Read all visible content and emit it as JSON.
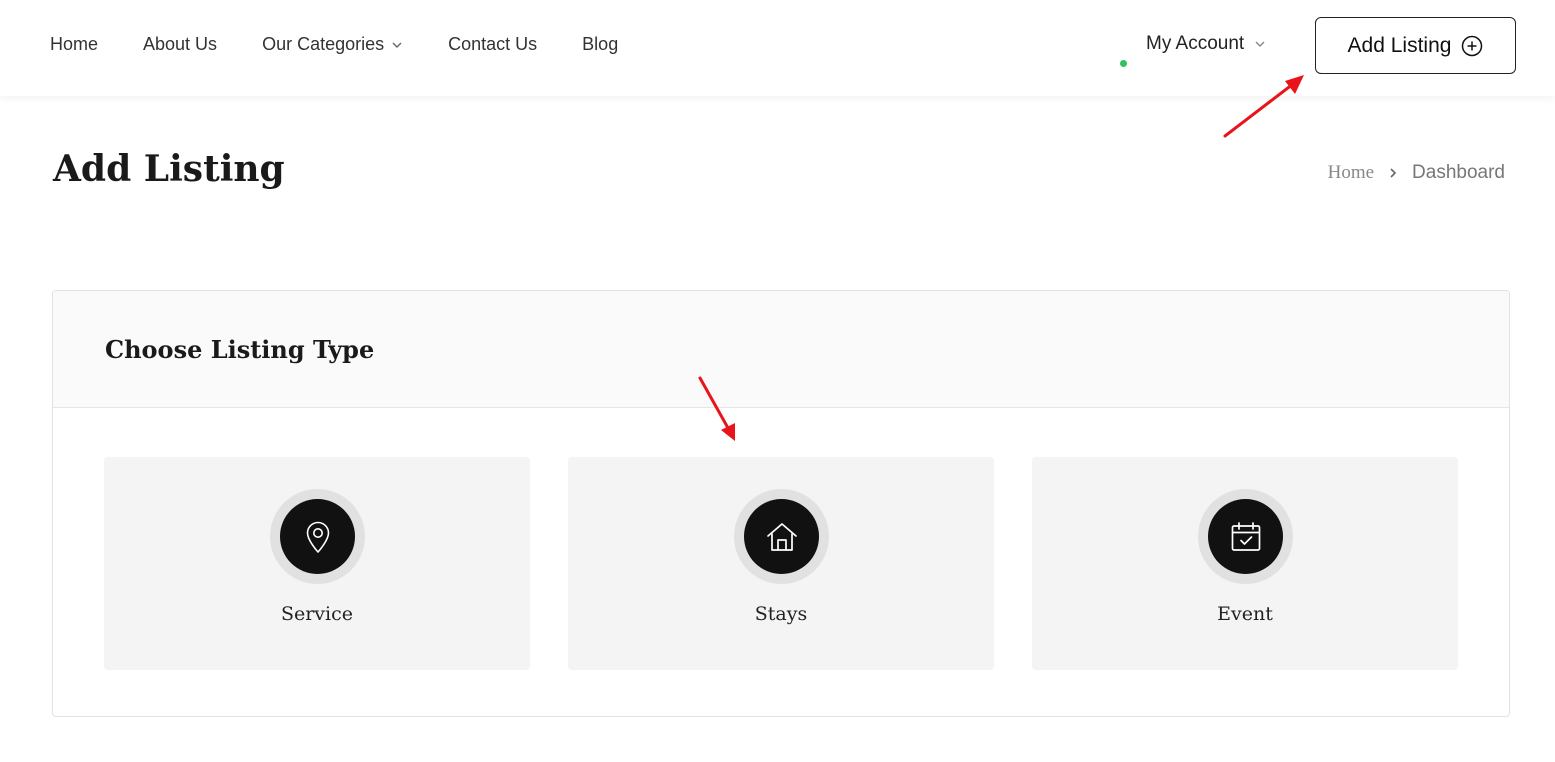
{
  "header": {
    "nav": [
      {
        "label": "Home"
      },
      {
        "label": "About Us"
      },
      {
        "label": "Our Categories",
        "has_dropdown": true
      },
      {
        "label": "Contact Us"
      },
      {
        "label": "Blog"
      }
    ],
    "account": {
      "label": "My Account",
      "status_color": "#2ec25b"
    },
    "add_listing_label": "Add Listing"
  },
  "page": {
    "title": "Add Listing",
    "breadcrumb": {
      "home": "Home",
      "current": "Dashboard"
    }
  },
  "panel": {
    "title": "Choose Listing Type",
    "cards": [
      {
        "label": "Service",
        "icon": "map-pin-icon"
      },
      {
        "label": "Stays",
        "icon": "house-icon"
      },
      {
        "label": "Event",
        "icon": "calendar-check-icon"
      }
    ]
  },
  "colors": {
    "accent_dark": "#111111",
    "card_bg": "#f4f4f4",
    "annotation_arrow": "#e8141a"
  }
}
